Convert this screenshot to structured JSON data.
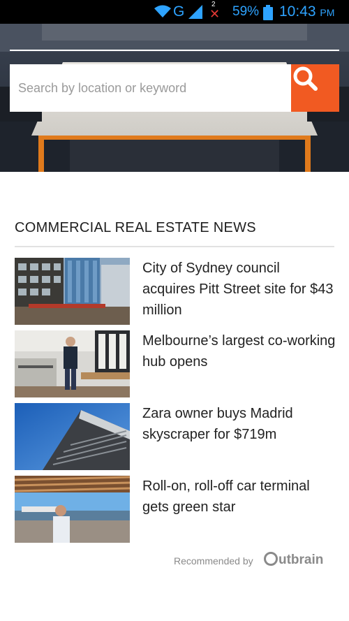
{
  "status_bar": {
    "network": "G",
    "sim_slot": "2",
    "battery_percent": "59%",
    "time": "10:43",
    "ampm": "PM"
  },
  "search": {
    "placeholder": "Search by location or keyword"
  },
  "news": {
    "section_title": "COMMERCIAL REAL ESTATE NEWS",
    "items": [
      {
        "headline": "City of Sydney council acquires Pitt Street site for $43 million"
      },
      {
        "headline": "Melbourne’s largest co-working hub opens"
      },
      {
        "headline": "Zara owner buys Madrid skyscraper for $719m"
      },
      {
        "headline": "Roll-on, roll-off car terminal gets green star"
      }
    ]
  },
  "footer": {
    "recommended_label": "Recommended by",
    "brand_rest": "utbrain"
  },
  "colors": {
    "accent": "#f15a22",
    "status_icons": "#2ea3ff"
  }
}
